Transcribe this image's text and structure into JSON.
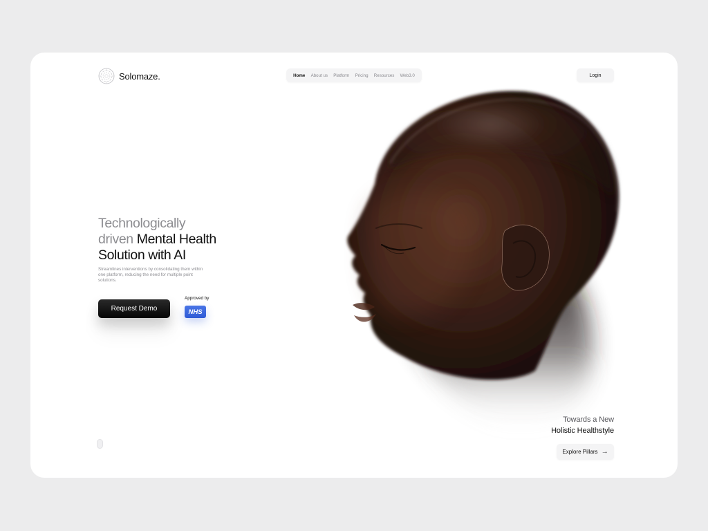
{
  "brand": {
    "name": "Solomaze.",
    "logo_icon": "circular-maze-icon"
  },
  "nav": {
    "items": [
      {
        "label": "Home",
        "active": true
      },
      {
        "label": "About us",
        "active": false
      },
      {
        "label": "Platform",
        "active": false
      },
      {
        "label": "Pricing",
        "active": false
      },
      {
        "label": "Resources",
        "active": false
      },
      {
        "label": "Web3.0",
        "active": false
      }
    ]
  },
  "header": {
    "login_label": "Login"
  },
  "hero": {
    "headline_line1": "Technologically",
    "headline_line2a": "driven",
    "headline_line2b": "Mental Health",
    "headline_line3": "Solution with AI",
    "subtext": "Streamlines interventions by consolidating them within one platform, reducing the need for multiple point solutions.",
    "cta_label": "Request Demo",
    "approved_label": "Approved by",
    "badge_label": "NHS"
  },
  "feature": {
    "tagline_line1": "Towards a New",
    "tagline_line2": "Holistic Healthstyle",
    "explore_label": "Explore Pillars",
    "explore_icon": "arrow-right-icon"
  },
  "colors": {
    "page_bg": "#ececed",
    "card_bg": "#ffffff",
    "headline_muted": "#8c8c90",
    "headline_dark": "#111111",
    "cta_bg": "#0a0a0a",
    "nhs_blue": "#2f5bd6",
    "skin_tone": "#3a2118"
  }
}
